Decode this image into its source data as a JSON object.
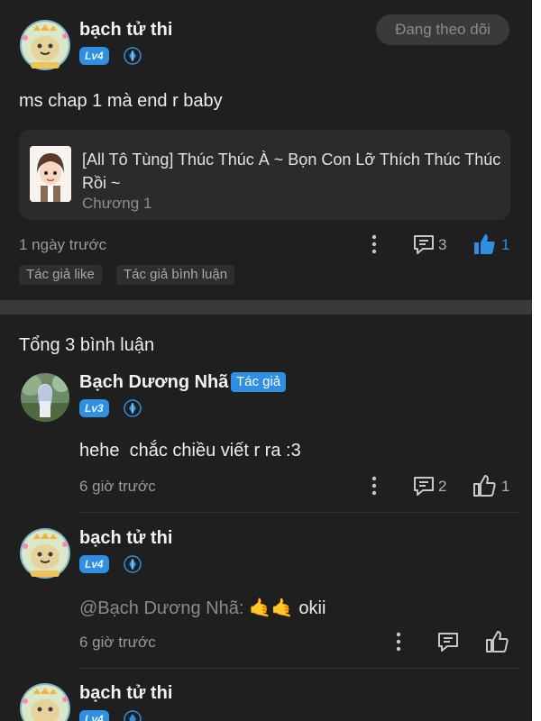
{
  "post": {
    "username": "bạch tử thi",
    "level": "Lv4",
    "follow_label": "Đang theo dõi",
    "text": "ms chap 1 mà end r baby",
    "card": {
      "title": "[All Tô Tùng] Thúc Thúc À ~ Bọn Con Lỡ Thích Thúc Thúc Rồi ~",
      "chapter": "Chương 1"
    },
    "time": "1 ngày trước",
    "reply_count": "3",
    "like_count": "1",
    "tags": [
      "Tác giả like",
      "Tác giả bình luận"
    ]
  },
  "replies_section": {
    "total_label": "Tổng 3 bình luận",
    "replies": [
      {
        "username": "Bạch Dương Nhã",
        "author_tag": "Tác giả",
        "level": "Lv3",
        "text": "hehe  chắc chiều viết r ra :3",
        "time": "6 giờ trước",
        "reply_count": "2",
        "like_count": "1"
      },
      {
        "username": "bạch tử thi",
        "level": "Lv4",
        "mention": "@Bạch Dương Nhã:",
        "emoji": "🤙🤙",
        "text": "okii",
        "time": "6 giờ trước"
      },
      {
        "username": "bạch tử thi",
        "level": "Lv4"
      }
    ]
  },
  "colors": {
    "background": "#1f1f1f",
    "accent_blue": "#2f8fe3",
    "card": "#2b2b2b",
    "muted_text": "#9a9a9a"
  },
  "icons": [
    "more-vertical-icon",
    "reply-comment-icon",
    "thumbs-up-icon",
    "diamond-gem-icon"
  ]
}
